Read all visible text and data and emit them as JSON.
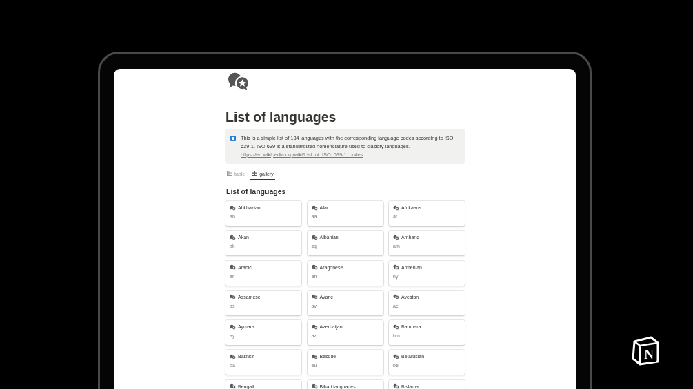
{
  "page": {
    "title": "List of languages"
  },
  "callout": {
    "text": "This is a simple list of 184 languages with the corresponding language codes according to ISO 639-1. ISO 639 is a standardized nomenclature used to classify languages.",
    "link": "https://en.wikipedia.org/wiki/List_of_ISO_639-1_codes"
  },
  "views": [
    {
      "label": "table",
      "kind": "table",
      "selected": false
    },
    {
      "label": "gallery",
      "kind": "gallery",
      "selected": true
    }
  ],
  "gallery": {
    "title": "List of languages",
    "cards": [
      {
        "name": "Abkhazian",
        "code": "ab"
      },
      {
        "name": "Afar",
        "code": "aa"
      },
      {
        "name": "Afrikaans",
        "code": "af"
      },
      {
        "name": "Akan",
        "code": "ak"
      },
      {
        "name": "Albanian",
        "code": "sq"
      },
      {
        "name": "Amharic",
        "code": "am"
      },
      {
        "name": "Arabic",
        "code": "ar"
      },
      {
        "name": "Aragonese",
        "code": "an"
      },
      {
        "name": "Armenian",
        "code": "hy"
      },
      {
        "name": "Assamese",
        "code": "as"
      },
      {
        "name": "Avaric",
        "code": "av"
      },
      {
        "name": "Avestan",
        "code": "ae"
      },
      {
        "name": "Aymara",
        "code": "ay"
      },
      {
        "name": "Azerbaijani",
        "code": "az"
      },
      {
        "name": "Bambara",
        "code": "bm"
      },
      {
        "name": "Bashkir",
        "code": "ba"
      },
      {
        "name": "Basque",
        "code": "eu"
      },
      {
        "name": "Belarusian",
        "code": "be"
      },
      {
        "name": "Bengali"
      },
      {
        "name": "Bihari languages"
      },
      {
        "name": "Bislama"
      }
    ]
  },
  "brand": {
    "letter": "N"
  }
}
